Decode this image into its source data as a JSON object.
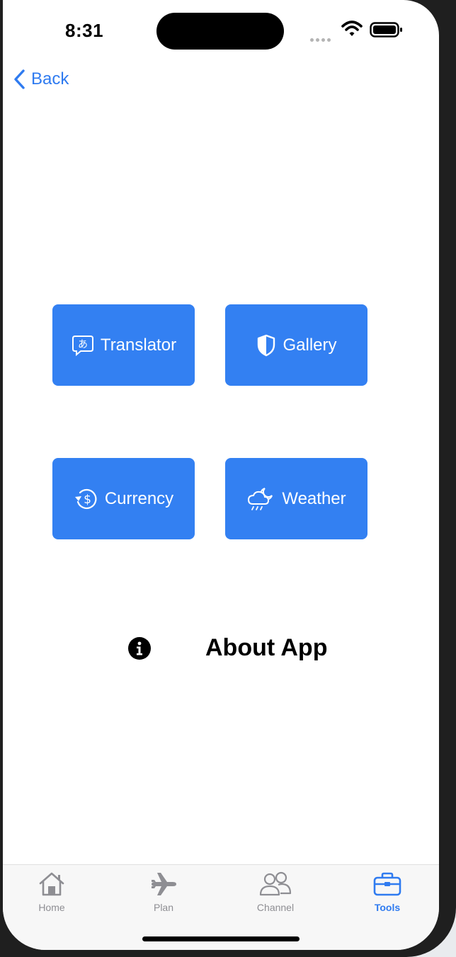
{
  "status_bar": {
    "time": "8:31"
  },
  "nav": {
    "back_label": "Back"
  },
  "tools": [
    {
      "label": "Translator",
      "icon": "translate-bubble-icon"
    },
    {
      "label": "Gallery",
      "icon": "shield-icon"
    },
    {
      "label": "Currency",
      "icon": "currency-exchange-icon"
    },
    {
      "label": "Weather",
      "icon": "cloud-moon-rain-icon"
    }
  ],
  "about": {
    "label": "About App",
    "icon": "info-circle-icon"
  },
  "tab_bar": {
    "items": [
      {
        "label": "Home",
        "icon": "home-icon",
        "active": false
      },
      {
        "label": "Plan",
        "icon": "airplane-icon",
        "active": false
      },
      {
        "label": "Channel",
        "icon": "people-icon",
        "active": false
      },
      {
        "label": "Tools",
        "icon": "briefcase-icon",
        "active": true
      }
    ]
  },
  "colors": {
    "accent": "#2f7bf0",
    "button_bg": "#3380f2",
    "inactive_tab": "#8e8e93"
  }
}
